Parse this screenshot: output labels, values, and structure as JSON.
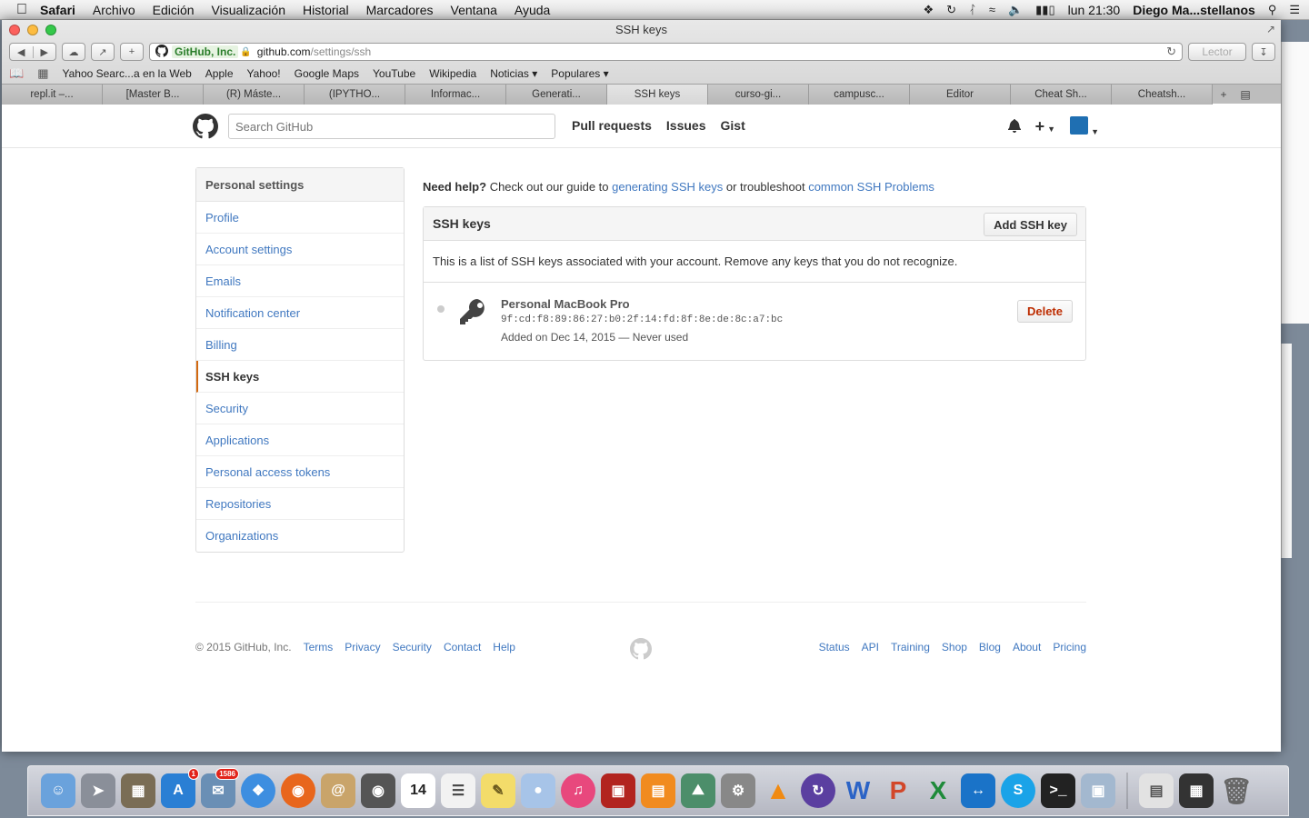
{
  "menubar": {
    "app": "Safari",
    "items": [
      "Archivo",
      "Edición",
      "Visualización",
      "Historial",
      "Marcadores",
      "Ventana",
      "Ayuda"
    ],
    "clock": "lun 21:30",
    "user": "Diego Ma...stellanos"
  },
  "window": {
    "title": "SSH keys",
    "address": {
      "ev_label": "GitHub, Inc.",
      "host": "github.com",
      "path": "/settings/ssh"
    },
    "reader_label": "Lector",
    "bookmarks": [
      "Yahoo Searc...a en la Web",
      "Apple",
      "Yahoo!",
      "Google Maps",
      "YouTube",
      "Wikipedia",
      "Noticias ▾",
      "Populares ▾"
    ],
    "tabs": [
      {
        "label": "repl.it –..."
      },
      {
        "label": "[Master B..."
      },
      {
        "label": "(R) Máste..."
      },
      {
        "label": "(IPYTHO..."
      },
      {
        "label": "Informac..."
      },
      {
        "label": "Generati..."
      },
      {
        "label": "SSH keys",
        "active": true
      },
      {
        "label": "curso-gi..."
      },
      {
        "label": "campusc..."
      },
      {
        "label": "Editor"
      },
      {
        "label": "Cheat Sh..."
      },
      {
        "label": "Cheatsh..."
      }
    ]
  },
  "github": {
    "search_placeholder": "Search GitHub",
    "nav": [
      "Pull requests",
      "Issues",
      "Gist"
    ],
    "plus_label": "+",
    "settings_menu": {
      "heading": "Personal settings",
      "items": [
        {
          "label": "Profile"
        },
        {
          "label": "Account settings"
        },
        {
          "label": "Emails"
        },
        {
          "label": "Notification center"
        },
        {
          "label": "Billing"
        },
        {
          "label": "SSH keys",
          "selected": true
        },
        {
          "label": "Security"
        },
        {
          "label": "Applications"
        },
        {
          "label": "Personal access tokens"
        },
        {
          "label": "Repositories"
        },
        {
          "label": "Organizations"
        }
      ]
    },
    "help": {
      "lead": "Need help?",
      "text1": " Check out our guide to ",
      "link1": "generating SSH keys",
      "text2": " or troubleshoot ",
      "link2": "common SSH Problems"
    },
    "panel": {
      "title": "SSH keys",
      "add_button": "Add SSH key",
      "description": "This is a list of SSH keys associated with your account. Remove any keys that you do not recognize.",
      "key": {
        "title": "Personal MacBook Pro",
        "fingerprint": "9f:cd:f8:89:86:27:b0:2f:14:fd:8f:8e:de:8c:a7:bc",
        "added": "Added on Dec 14, 2015 — Never used",
        "delete_button": "Delete"
      }
    },
    "footer": {
      "copyright": "© 2015 GitHub, Inc.",
      "left_links": [
        "Terms",
        "Privacy",
        "Security",
        "Contact",
        "Help"
      ],
      "right_links": [
        "Status",
        "API",
        "Training",
        "Shop",
        "Blog",
        "About",
        "Pricing"
      ]
    }
  },
  "dock": {
    "app_store_badge": "1",
    "mail_badge": "1586",
    "calendar_day": "14"
  },
  "colors": {
    "link": "#4078c0",
    "selected_accent": "#d26911",
    "danger": "#bd2c00"
  }
}
